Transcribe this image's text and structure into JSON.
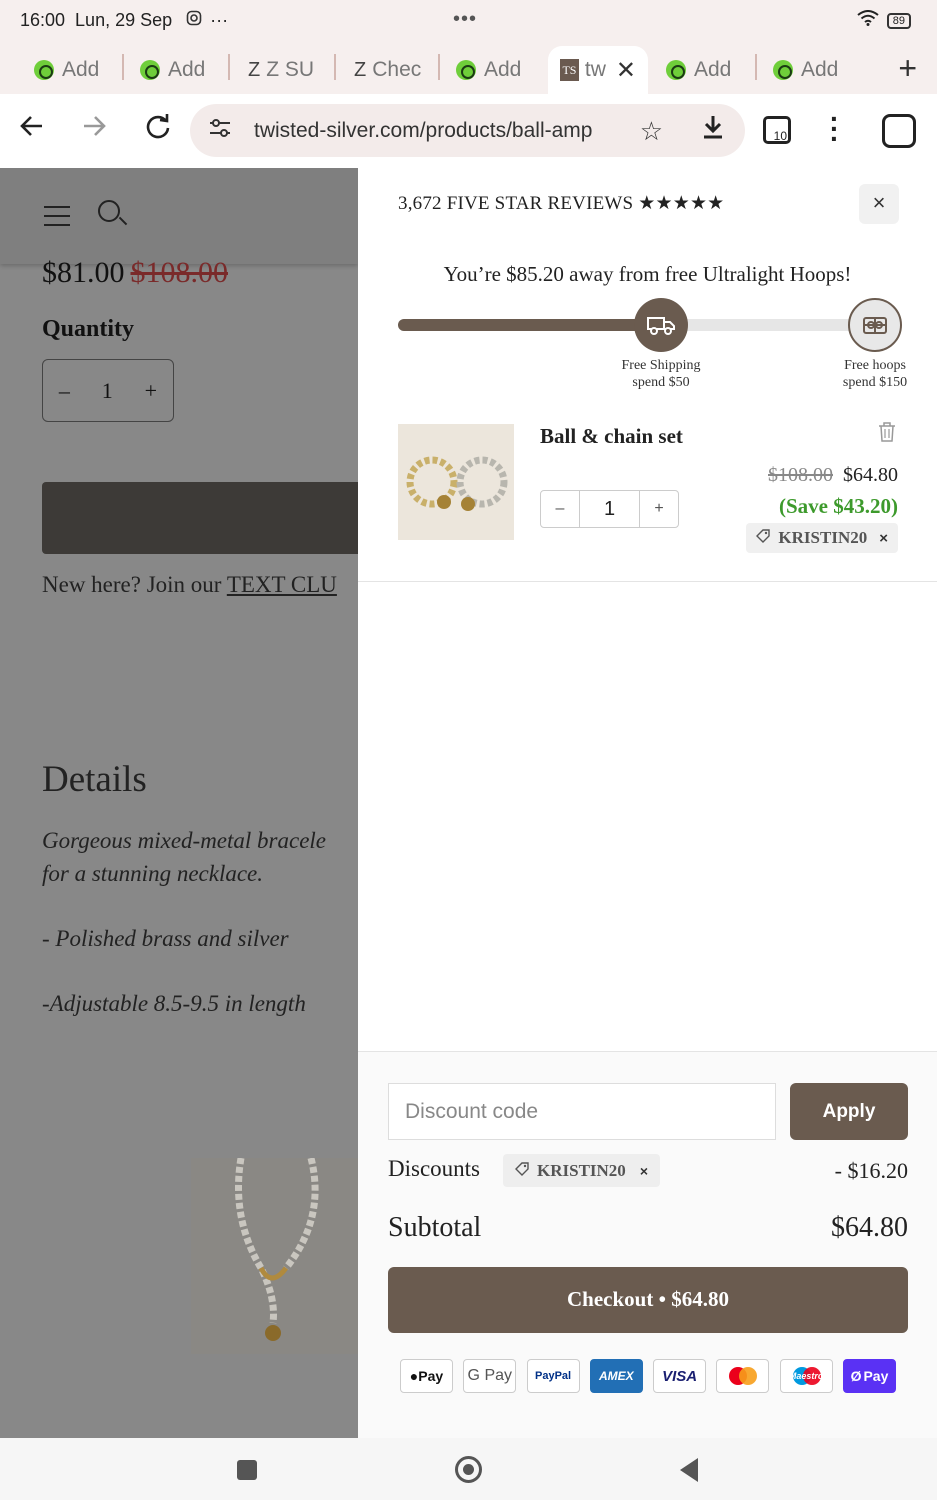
{
  "status_bar": {
    "time": "16:00",
    "date": "Lun, 29 Sep",
    "more": "···",
    "center_dots": "•••",
    "battery": "89"
  },
  "tabs": [
    {
      "label": "Add",
      "type": "green"
    },
    {
      "label": "Add",
      "type": "green"
    },
    {
      "label": "Z SU",
      "type": "z"
    },
    {
      "label": "Chec",
      "type": "z"
    },
    {
      "label": "Add",
      "type": "green"
    },
    {
      "label": "tw",
      "type": "active"
    },
    {
      "label": "Add",
      "type": "green"
    },
    {
      "label": "Add",
      "type": "green"
    }
  ],
  "browser": {
    "url": "twisted-silver.com/products/ball-amp",
    "tab_count": "10"
  },
  "background_page": {
    "price": "$81.00",
    "old_price": "$108.00",
    "quantity_label": "Quantity",
    "quantity_minus": "–",
    "quantity_value": "1",
    "quantity_plus": "+",
    "join_prefix": "New here? Join our ",
    "join_link": "TEXT CLU",
    "details_title": "Details",
    "desc_1": "Gorgeous mixed-metal bracele",
    "desc_2": "for a stunning necklace.",
    "desc_3": "- Polished brass and silver",
    "desc_4": "-Adjustable 8.5-9.5 in length"
  },
  "cart": {
    "reviews": "3,672 FIVE STAR REVIEWS ★★★★★",
    "close": "×",
    "away_message": "You’re $85.20 away from free Ultralight Hoops!",
    "progress_fraction": 0.55,
    "milestones": [
      {
        "line1": "Free Shipping",
        "line2": "spend $50"
      },
      {
        "line1": "Free hoops",
        "line2": "spend $150"
      }
    ],
    "item": {
      "name": "Ball & chain set",
      "qty_minus": "–",
      "qty": "1",
      "qty_plus": "+",
      "was_price": "$108.00",
      "price": "$64.80",
      "save": "(Save $43.20)",
      "code": "KRISTIN20",
      "code_remove": "×"
    },
    "discount_placeholder": "Discount code",
    "apply_label": "Apply",
    "discounts_label": "Discounts",
    "discount_code": "KRISTIN20",
    "discount_remove": "×",
    "discount_amount": "- $16.20",
    "subtotal_label": "Subtotal",
    "subtotal_amount": "$64.80",
    "checkout_label": "Checkout • $64.80",
    "payment_methods": [
      "Pay",
      "G Pay",
      "PayPal",
      "AMEX",
      "VISA",
      "",
      "Maestro",
      "Pay"
    ]
  },
  "colors": {
    "accent": "#6a5b4f",
    "save_green": "#3d9a2c",
    "strike_red": "#7a2a2a"
  }
}
